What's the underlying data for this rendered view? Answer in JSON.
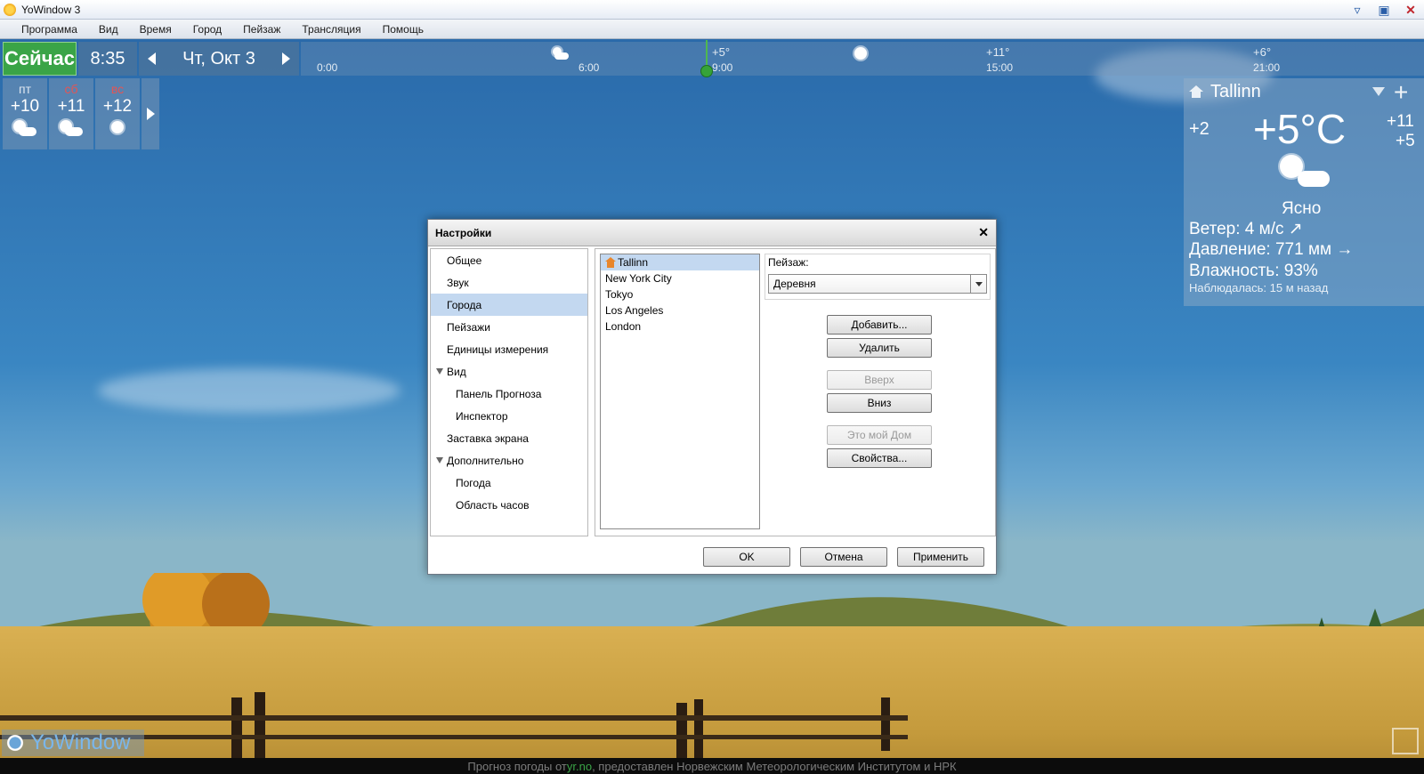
{
  "window": {
    "title": "YoWindow 3"
  },
  "menu": [
    "Программа",
    "Вид",
    "Время",
    "Город",
    "Пейзаж",
    "Трансляция",
    "Помощь"
  ],
  "topbar": {
    "now_label": "Сейчас",
    "time": "8:35",
    "date": "Чт, Окт 3"
  },
  "timeline": {
    "hours": [
      "0:00",
      "6:00",
      "9:00",
      "15:00",
      "21:00"
    ],
    "temps": [
      "+5°",
      "+11°",
      "+6°"
    ]
  },
  "forecast": [
    {
      "day": "пт",
      "temp": "+10",
      "icon": "sun-cloud-icon"
    },
    {
      "day": "сб",
      "temp": "+11",
      "icon": "sun-cloud-icon"
    },
    {
      "day": "вс",
      "temp": "+12",
      "icon": "sun-icon"
    }
  ],
  "city_panel": {
    "city": "Tallinn",
    "feels": "+2",
    "temp": "+5°C",
    "hi": "+11",
    "lo": "+5",
    "condition": "Ясно",
    "wind": "Ветер:  4 м/с",
    "pressure": "Давление:  771 мм",
    "humidity": "Влажность:  93%",
    "observed": "Наблюдалась:  15 м назад"
  },
  "logo_text": "YoWindow",
  "footer": {
    "prefix": "Прогноз погоды от ",
    "link": "yr.no",
    "suffix": ", предоставлен Норвежским Метеорологическим Институтом и НРК"
  },
  "dialog": {
    "title": "Настройки",
    "nav": [
      {
        "label": "Общее",
        "level": 0
      },
      {
        "label": "Звук",
        "level": 0
      },
      {
        "label": "Города",
        "level": 0,
        "selected": true
      },
      {
        "label": "Пейзажи",
        "level": 0
      },
      {
        "label": "Единицы измерения",
        "level": 0
      },
      {
        "label": "Вид",
        "level": 0,
        "expanded": true
      },
      {
        "label": "Панель Прогноза",
        "level": 1
      },
      {
        "label": "Инспектор",
        "level": 1
      },
      {
        "label": "Заставка экрана",
        "level": 0
      },
      {
        "label": "Дополнительно",
        "level": 0,
        "expanded": true
      },
      {
        "label": "Погода",
        "level": 1
      },
      {
        "label": "Область часов",
        "level": 1
      }
    ],
    "cities": [
      "Tallinn",
      "New York City",
      "Tokyo",
      "Los Angeles",
      "London"
    ],
    "landscape_label": "Пейзаж:",
    "landscape_value": "Деревня",
    "buttons": {
      "add": "Добавить...",
      "remove": "Удалить",
      "up": "Вверх",
      "down": "Вниз",
      "home": "Это мой Дом",
      "props": "Свойства..."
    },
    "ok": "OK",
    "cancel": "Отмена",
    "apply": "Применить"
  }
}
